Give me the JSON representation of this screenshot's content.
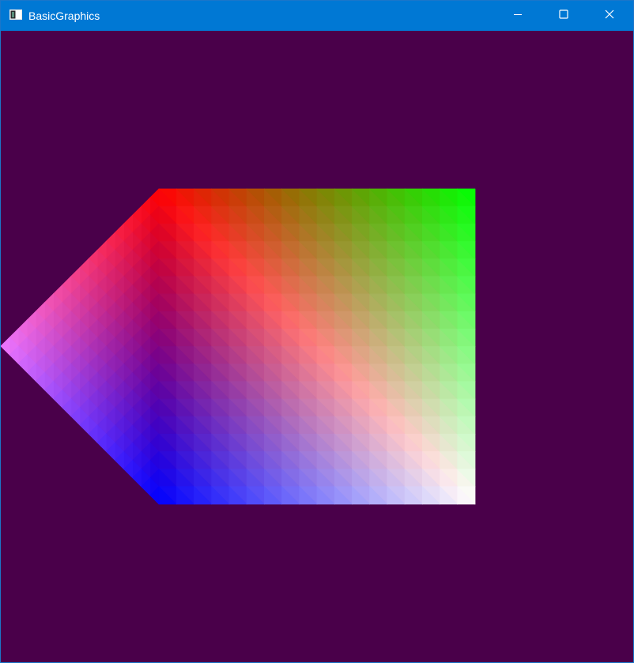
{
  "window": {
    "title": "BasicGraphics",
    "title_bar_color": "#0078d4",
    "border_color": "#1b76c9",
    "controls": [
      "minimize-icon",
      "maximize-icon",
      "close-icon"
    ]
  },
  "viewport": {
    "clear_color": "#4a004a",
    "shape": {
      "kind": "pentagon",
      "vertex_colors": [
        "#ff0000",
        "#00ff00",
        "#ffffff",
        "#0000ff",
        "#ee77ff"
      ]
    }
  }
}
